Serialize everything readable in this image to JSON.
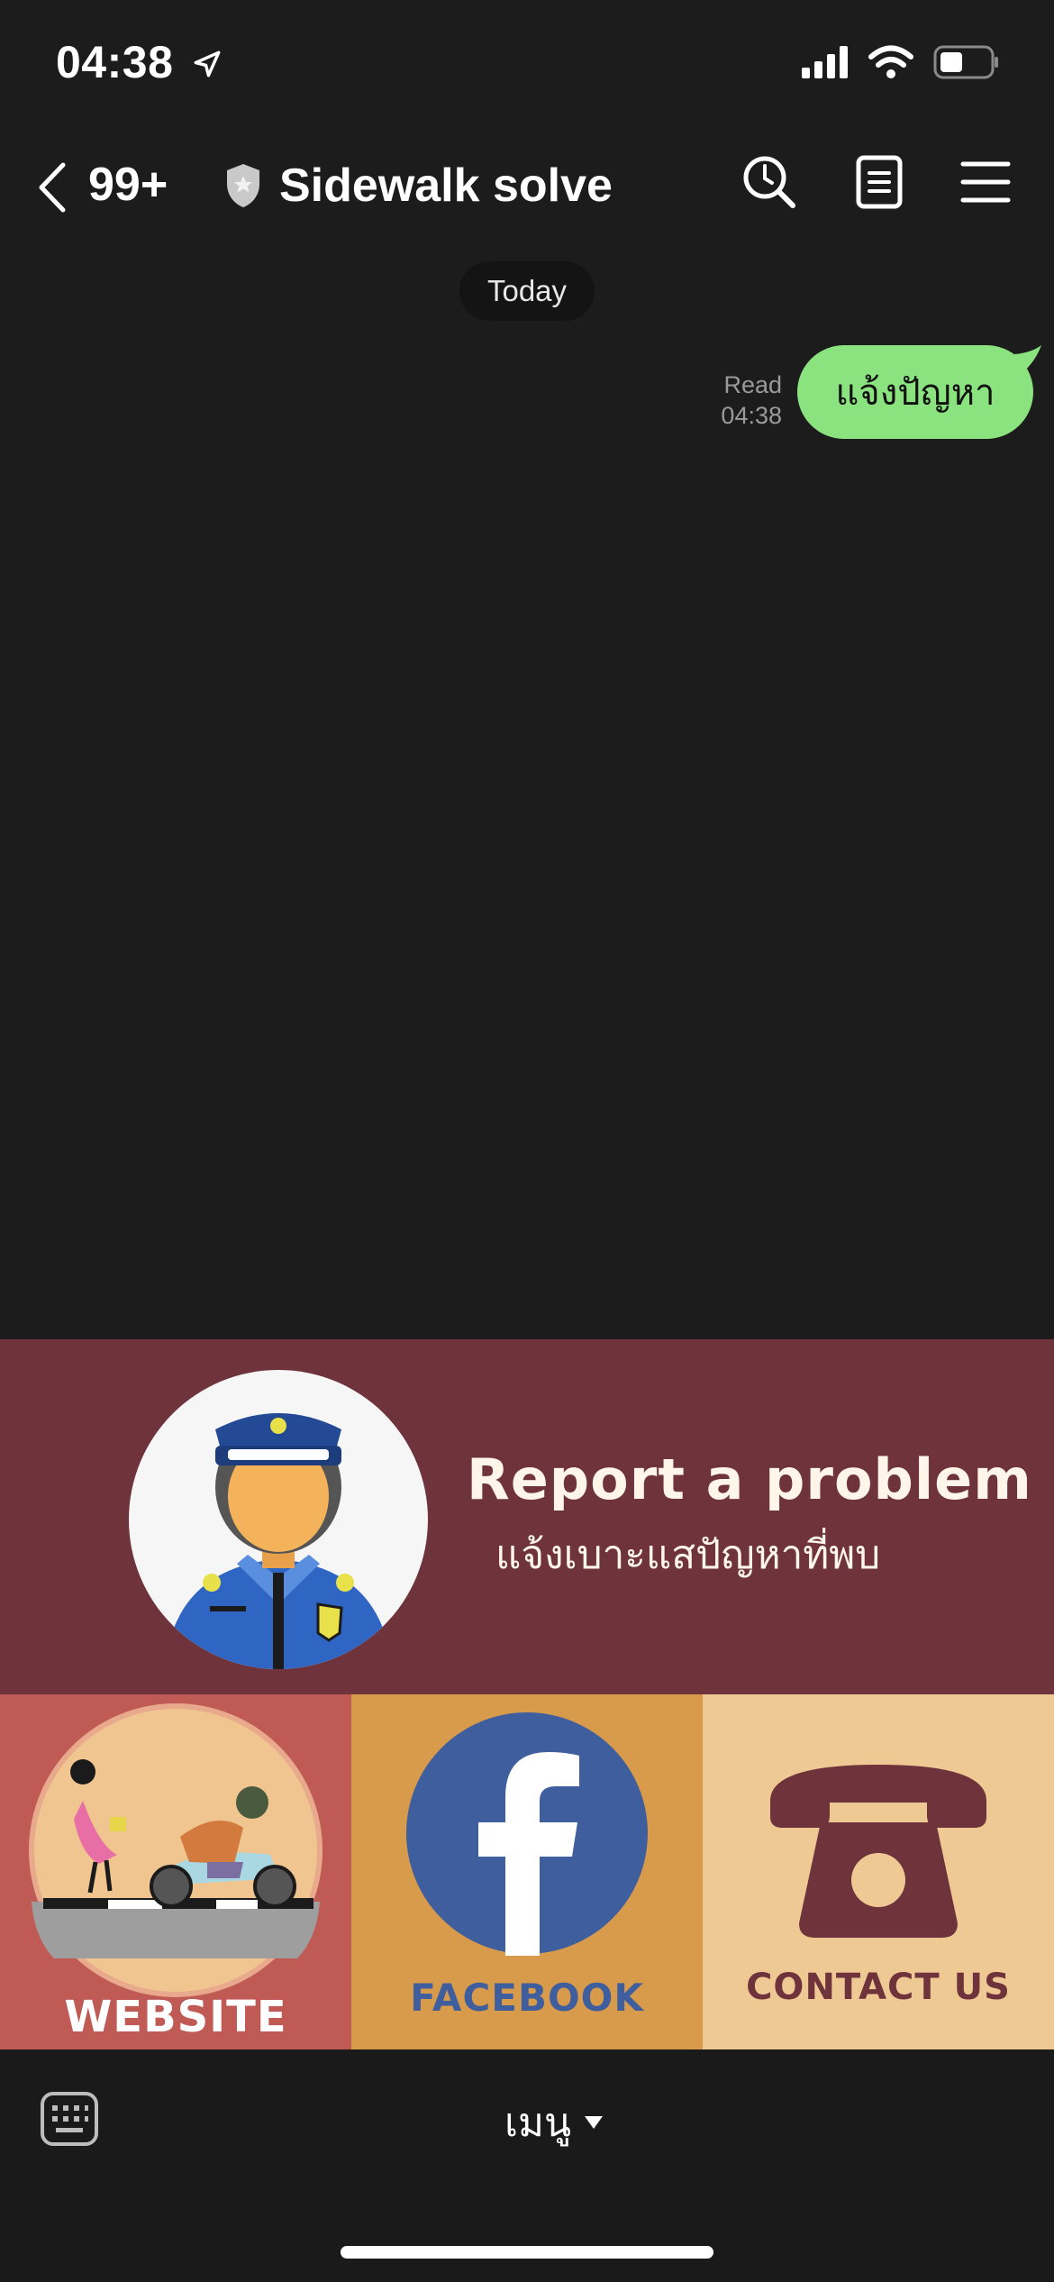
{
  "status_bar": {
    "time": "04:38"
  },
  "header": {
    "back_count": "99+",
    "title": "Sidewalk solve"
  },
  "chat": {
    "date_label": "Today",
    "messages": [
      {
        "text": "แจ้งปัญหา",
        "status": "Read",
        "time": "04:38",
        "sender": "me"
      }
    ]
  },
  "rich_menu": {
    "report": {
      "title": "Report a problem",
      "subtitle": "แจ้งเบาะแสปัญหาที่พบ"
    },
    "buttons": [
      {
        "label": "WEBSITE"
      },
      {
        "label": "FACEBOOK"
      },
      {
        "label": "CONTACT US"
      }
    ]
  },
  "bottom_bar": {
    "menu_label": "เมนู"
  },
  "colors": {
    "background": "#1c1c1d",
    "bubble": "#8be37f",
    "report_bg": "#6e333b",
    "website_bg": "#c05a54",
    "facebook_bg": "#d89a4b",
    "contact_bg": "#eec994"
  }
}
